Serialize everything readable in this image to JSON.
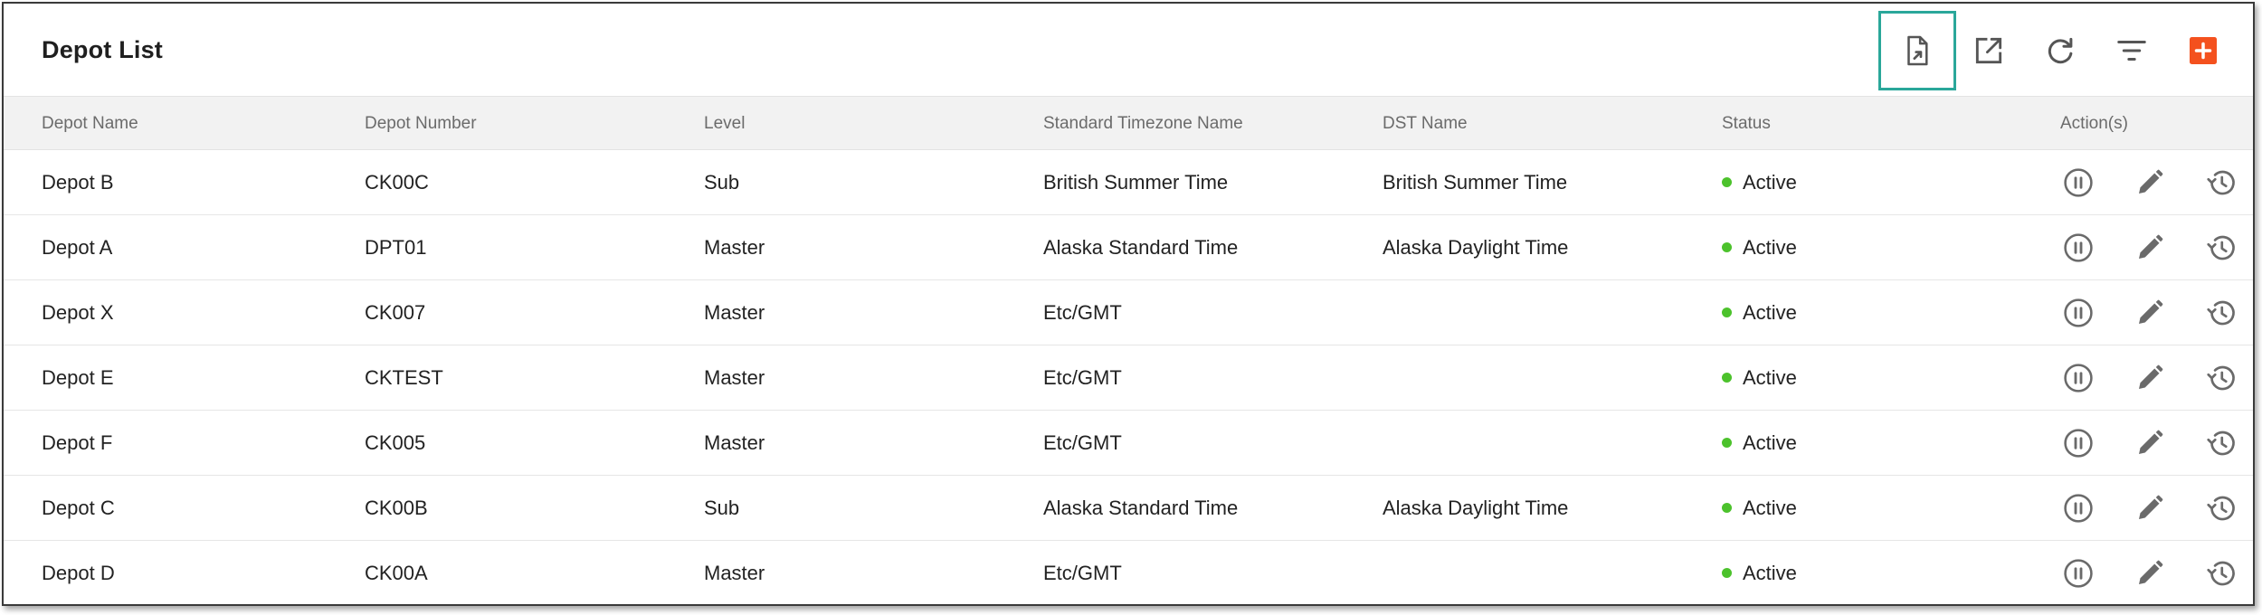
{
  "page": {
    "title": "Depot List"
  },
  "toolbar": {
    "buttons": [
      {
        "name": "export-file-button",
        "icon": "export-file-icon"
      },
      {
        "name": "open-external-button",
        "icon": "open-in-new-icon"
      },
      {
        "name": "refresh-button",
        "icon": "refresh-icon"
      },
      {
        "name": "filter-button",
        "icon": "filter-icon"
      },
      {
        "name": "add-depot-button",
        "icon": "plus-icon"
      }
    ],
    "accent_color": "#f4511e",
    "highlight_color": "#2aa79a"
  },
  "table": {
    "columns": [
      "Depot Name",
      "Depot Number",
      "Level",
      "Standard Timezone Name",
      "DST Name",
      "Status",
      "Action(s)"
    ],
    "rows": [
      {
        "name": "Depot B",
        "number": "CK00C",
        "level": "Sub",
        "timezone": "British Summer Time",
        "dst": "British Summer Time",
        "status": "Active"
      },
      {
        "name": "Depot A",
        "number": "DPT01",
        "level": "Master",
        "timezone": "Alaska Standard Time",
        "dst": "Alaska Daylight Time",
        "status": "Active"
      },
      {
        "name": "Depot X",
        "number": "CK007",
        "level": "Master",
        "timezone": "Etc/GMT",
        "dst": "",
        "status": "Active"
      },
      {
        "name": "Depot E",
        "number": "CKTEST",
        "level": "Master",
        "timezone": "Etc/GMT",
        "dst": "",
        "status": "Active"
      },
      {
        "name": "Depot F",
        "number": "CK005",
        "level": "Master",
        "timezone": "Etc/GMT",
        "dst": "",
        "status": "Active"
      },
      {
        "name": "Depot C",
        "number": "CK00B",
        "level": "Sub",
        "timezone": "Alaska Standard Time",
        "dst": "Alaska Daylight Time",
        "status": "Active"
      },
      {
        "name": "Depot D",
        "number": "CK00A",
        "level": "Master",
        "timezone": "Etc/GMT",
        "dst": "",
        "status": "Active"
      }
    ],
    "status_color": "#4cc22c",
    "row_actions": [
      "pause-icon",
      "edit-icon",
      "history-icon"
    ]
  }
}
